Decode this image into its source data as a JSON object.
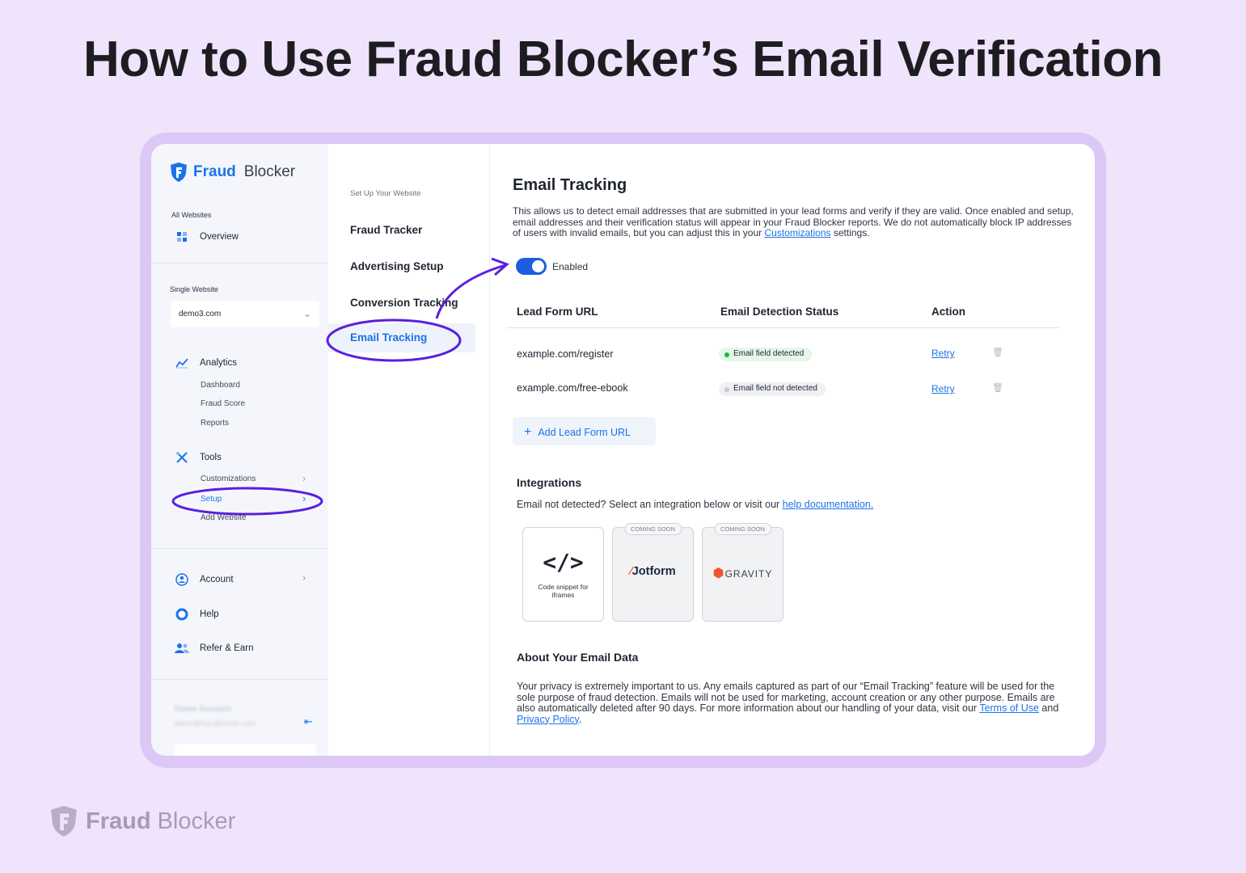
{
  "headline": "How to Use Fraud Blocker’s Email Verification",
  "brand": {
    "part1": "Fraud",
    "part2": "Blocker"
  },
  "sidebar": {
    "all_websites_label": "All Websites",
    "overview": "Overview",
    "single_website_label": "Single Website",
    "site_select_value": "demo3.com",
    "analytics": {
      "label": "Analytics",
      "items": [
        "Dashboard",
        "Fraud Score",
        "Reports"
      ]
    },
    "tools": {
      "label": "Tools",
      "items": [
        "Customizations",
        "Setup",
        "Add Website"
      ]
    },
    "account": "Account",
    "help": "Help",
    "refer": "Refer & Earn",
    "user_name": "Demo Account",
    "user_email": "demo@fraudblocker.com"
  },
  "midnav": {
    "caption": "Set Up Your Website",
    "items": [
      "Fraud Tracker",
      "Advertising Setup",
      "Conversion Tracking",
      "Email Tracking"
    ]
  },
  "main": {
    "title": "Email Tracking",
    "desc_before": "This allows us to detect email addresses that are submitted in your lead forms and verify if they are valid. Once enabled and setup, email addresses and their verification status will appear in your Fraud Blocker reports. We do not automatically block IP addresses of users with invalid emails, but you can adjust this in your ",
    "desc_link": "Customizations",
    "desc_after": " settings.",
    "toggle_label": "Enabled",
    "table": {
      "headers": [
        "Lead Form URL",
        "Email Detection Status",
        "Action"
      ],
      "rows": [
        {
          "url": "example.com/register",
          "status": "Email field detected",
          "action": "Retry"
        },
        {
          "url": "example.com/free-ebook",
          "status": "Email field not detected",
          "action": "Retry"
        }
      ]
    },
    "add_button": "Add Lead Form URL",
    "integrations": {
      "title": "Integrations",
      "text": "Email not detected? Select an integration below or visit our ",
      "link": "help documentation.",
      "cards": [
        {
          "name": "Code snippet for iframes",
          "code": "</>"
        },
        {
          "name": "Jotform",
          "tag": "COMING SOON"
        },
        {
          "name": "GRAVITY",
          "tag": "COMING SOON"
        }
      ]
    },
    "about": {
      "title": "About Your Email Data",
      "text": "Your privacy is extremely important to us. Any emails captured as part of our “Email Tracking” feature will be used for the sole purpose of fraud detection. Emails will not be used for marketing, account creation or any other purpose. Emails are also automatically deleted after 90 days. For more information about our handling of your data, visit our ",
      "link1": "Terms of Use",
      "and": " and ",
      "link2": "Privacy Policy",
      "end": "."
    }
  },
  "colors": {
    "accent": "#1b73e8",
    "annotation": "#5b1ee0",
    "background": "#efe4fb"
  }
}
